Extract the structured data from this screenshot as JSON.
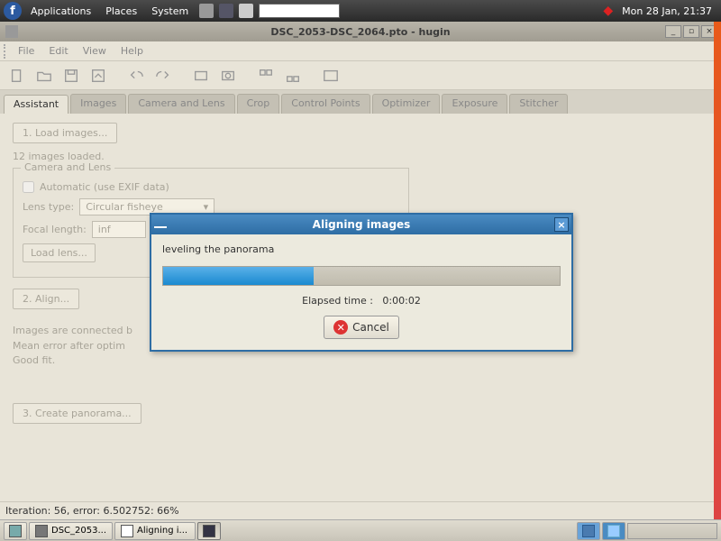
{
  "panel": {
    "menus": [
      "Applications",
      "Places",
      "System"
    ],
    "clock": "Mon 28 Jan, 21:37"
  },
  "window": {
    "title": "DSC_2053-DSC_2064.pto - hugin",
    "menubar": [
      "File",
      "Edit",
      "View",
      "Help"
    ],
    "tabs": [
      "Assistant",
      "Images",
      "Camera and Lens",
      "Crop",
      "Control Points",
      "Optimizer",
      "Exposure",
      "Stitcher"
    ],
    "step1_label": "1. Load images...",
    "images_loaded": "12 images loaded.",
    "lens_legend": "Camera and Lens",
    "auto_exif": "Automatic (use EXIF data)",
    "lens_type_label": "Lens type:",
    "lens_type_value": "Circular fisheye",
    "focal_label": "Focal length:",
    "focal_value": "inf",
    "load_lens": "Load lens...",
    "step2_label": "2. Align...",
    "align_status": "Images are connected b\nMean error after optim\nGood fit.",
    "step3_label": "3. Create panorama...",
    "statusbar": "Iteration: 56, error: 6.502752: 66%"
  },
  "dialog": {
    "title": "Aligning images",
    "message": "leveling the panorama",
    "elapsed_label": "Elapsed time :",
    "elapsed_value": "0:00:02",
    "cancel": "Cancel"
  },
  "taskbar": {
    "items": [
      "DSC_2053...",
      "Aligning i..."
    ]
  }
}
